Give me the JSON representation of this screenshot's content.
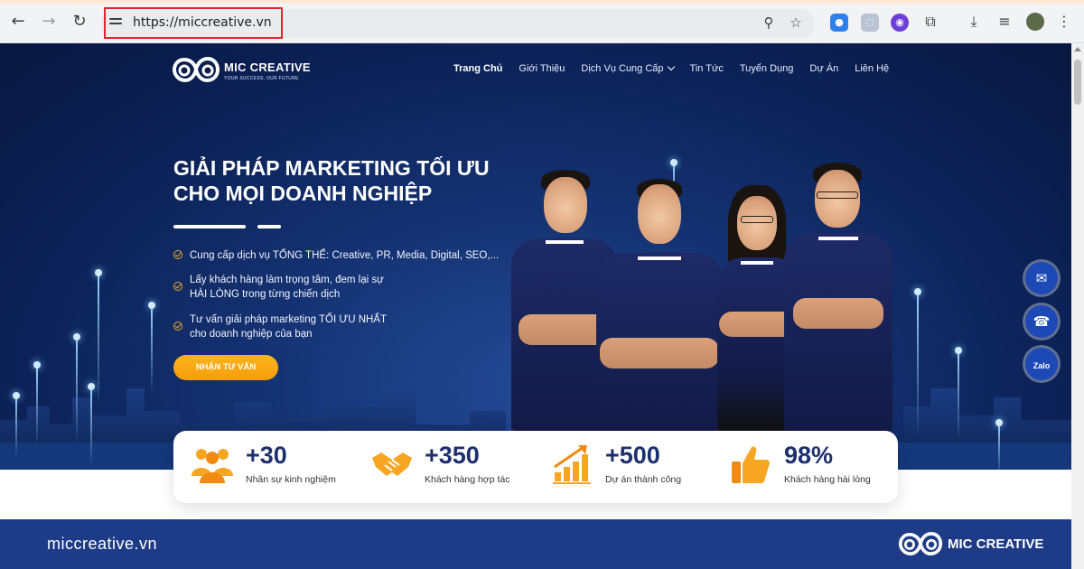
{
  "browser": {
    "url": "https://miccreative.vn",
    "icons": [
      "back-icon",
      "forward-icon",
      "reload-icon",
      "site-info-icon",
      "zoom-icon",
      "bookmark-star-icon",
      "extensions-icon",
      "download-icon",
      "media-icon",
      "profile-avatar",
      "menu-icon"
    ]
  },
  "site": {
    "brand": "MIC CREATIVE",
    "tagline": "YOUR SUCCESS, OUR FUTURE",
    "menu": [
      {
        "label": "Trang Chủ",
        "active": true
      },
      {
        "label": "Giới Thiệu"
      },
      {
        "label": "Dịch Vụ Cung Cấp",
        "has_dropdown": true
      },
      {
        "label": "Tin Tức"
      },
      {
        "label": "Tuyển Dụng"
      },
      {
        "label": "Dự Án"
      },
      {
        "label": "Liên Hệ"
      }
    ]
  },
  "hero": {
    "headline_line1": "GIẢI PHÁP MARKETING TỐI ƯU",
    "headline_line2": "CHO MỌI DOANH NGHIỆP",
    "bullets": [
      {
        "line1": "Cung cấp dịch vụ TỔNG THỂ: Creative, PR, Media, Digital, SEO,...",
        "line2": ""
      },
      {
        "line1": "Lấy khách hàng làm trọng tâm, đem lại sự",
        "line2": "HÀI LÒNG trong từng chiến dịch"
      },
      {
        "line1": "Tư vấn giải pháp marketing TỐI ƯU NHẤT",
        "line2": "cho doanh nghiệp của bạn"
      }
    ],
    "cta": "NHẬN TƯ VẤN"
  },
  "floating": [
    {
      "icon": "messenger-icon"
    },
    {
      "icon": "phone-icon"
    },
    {
      "icon": "zalo-icon",
      "label": "Zalo"
    }
  ],
  "stats": [
    {
      "number": "+30",
      "label": "Nhân sự kinh nghiệm",
      "icon": "team-icon"
    },
    {
      "number": "+350",
      "label": "Khách hàng hợp tác",
      "icon": "handshake-icon"
    },
    {
      "number": "+500",
      "label": "Dự án thành công",
      "icon": "growth-chart-icon"
    },
    {
      "number": "98%",
      "label": "Khách hàng hài lòng",
      "icon": "thumbs-up-icon"
    }
  ],
  "footer": {
    "url": "miccreative.vn",
    "brand": "MIC CREATIVE"
  },
  "colors": {
    "hero_dark": "#0b1f52",
    "accent_orange": "#f6a623",
    "footer_blue": "#1e3b87",
    "highlight_red": "#e0252b",
    "stat_text": "#1c2f6e"
  }
}
